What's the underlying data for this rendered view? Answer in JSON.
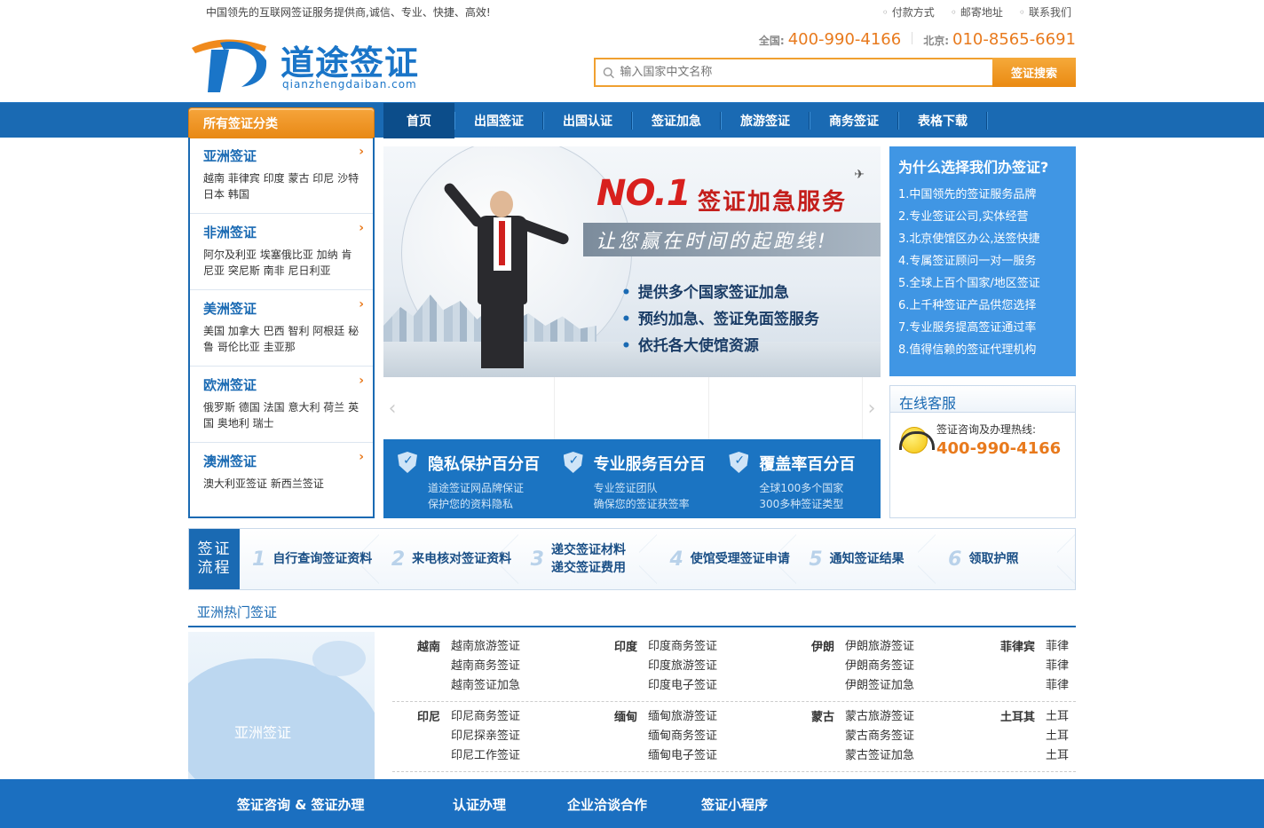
{
  "top": {
    "slogan": "中国领先的互联网签证服务提供商,诚信、专业、快捷、高效!",
    "links": [
      "付款方式",
      "邮寄地址",
      "联系我们"
    ]
  },
  "header": {
    "logo_name": "道途签证",
    "logo_domain": "qianzhengdaiban.com",
    "hotline_nat_label": "全国:",
    "hotline_nat": "400-990-4166",
    "hotline_bj_label": "北京:",
    "hotline_bj": "010-8565-6691",
    "search_placeholder": "输入国家中文名称",
    "search_button": "签证搜索"
  },
  "nav": {
    "category_title": "所有签证分类",
    "items": [
      "首页",
      "出国签证",
      "出国认证",
      "签证加急",
      "旅游签证",
      "商务签证",
      "表格下载"
    ]
  },
  "categories": [
    {
      "title": "亚洲签证",
      "countries": "越南 菲律宾 印度 蒙古 印尼 沙特 日本 韩国"
    },
    {
      "title": "非洲签证",
      "countries": "阿尔及利亚 埃塞俄比亚 加纳 肯尼亚 突尼斯 南非 尼日利亚"
    },
    {
      "title": "美洲签证",
      "countries": "美国 加拿大 巴西 智利 阿根廷 秘鲁 哥伦比亚 圭亚那"
    },
    {
      "title": "欧洲签证",
      "countries": "俄罗斯 德国 法国 意大利 荷兰 英国 奥地利 瑞士"
    },
    {
      "title": "澳洲签证",
      "countries": "澳大利亚签证 新西兰签证"
    }
  ],
  "banner": {
    "no1": "NO.1",
    "title": "签证加急服务",
    "subtitle": "让您赢在时间的起跑线!",
    "bullets": [
      "提供多个国家签证加急",
      "预约加急、签证免面签服务",
      "依托各大使馆资源"
    ]
  },
  "features": [
    {
      "title": "隐私保护百分百",
      "l1": "道途签证网品牌保证",
      "l2": "保护您的资料隐私"
    },
    {
      "title": "专业服务百分百",
      "l1": "专业签证团队",
      "l2": "确保您的签证获签率"
    },
    {
      "title": "覆盖率百分百",
      "l1": "全球100多个国家",
      "l2": "300多种签证类型"
    }
  ],
  "why": {
    "title": "为什么选择我们办签证?",
    "items": [
      "1.中国领先的签证服务品牌",
      "2.专业签证公司,实体经营",
      "3.北京使馆区办公,送签快捷",
      "4.专属签证顾问一对一服务",
      "5.全球上百个国家/地区签证",
      "6.上千种签证产品供您选择",
      "7.专业服务提高签证通过率",
      "8.值得信赖的签证代理机构"
    ]
  },
  "service": {
    "title": "在线客服",
    "question": "签证咨询及办理热线:",
    "phone": "400-990-4166"
  },
  "process": {
    "label1": "签证",
    "label2": "流程",
    "steps": [
      {
        "n": "1",
        "a": "自行查询签证资料",
        "b": ""
      },
      {
        "n": "2",
        "a": "来电核对签证资料",
        "b": ""
      },
      {
        "n": "3",
        "a": "递交签证材料",
        "b": "递交签证费用"
      },
      {
        "n": "4",
        "a": "使馆受理签证申请",
        "b": ""
      },
      {
        "n": "5",
        "a": "通知签证结果",
        "b": ""
      },
      {
        "n": "6",
        "a": "领取护照",
        "b": ""
      }
    ]
  },
  "asia": {
    "title": "亚洲热门签证",
    "map_label": "亚洲签证",
    "groups": [
      [
        {
          "country": "越南",
          "visas": [
            "越南旅游签证",
            "越南商务签证",
            "越南签证加急"
          ]
        },
        {
          "country": "印度",
          "visas": [
            "印度商务签证",
            "印度旅游签证",
            "印度电子签证"
          ]
        },
        {
          "country": "伊朗",
          "visas": [
            "伊朗旅游签证",
            "伊朗商务签证",
            "伊朗签证加急"
          ]
        },
        {
          "country": "菲律宾",
          "visas": [
            "菲律",
            "菲律",
            "菲律"
          ]
        }
      ],
      [
        {
          "country": "印尼",
          "visas": [
            "印尼商务签证",
            "印尼探亲签证",
            "印尼工作签证"
          ]
        },
        {
          "country": "缅甸",
          "visas": [
            "缅甸旅游签证",
            "缅甸商务签证",
            "缅甸电子签证"
          ]
        },
        {
          "country": "蒙古",
          "visas": [
            "蒙古旅游签证",
            "蒙古商务签证",
            "蒙古签证加急"
          ]
        },
        {
          "country": "土耳其",
          "visas": [
            "土耳",
            "土耳",
            "土耳"
          ]
        }
      ]
    ]
  },
  "footer": {
    "items": [
      "签证咨询 & 签证办理",
      "认证办理",
      "企业洽谈合作",
      "签证小程序"
    ]
  }
}
